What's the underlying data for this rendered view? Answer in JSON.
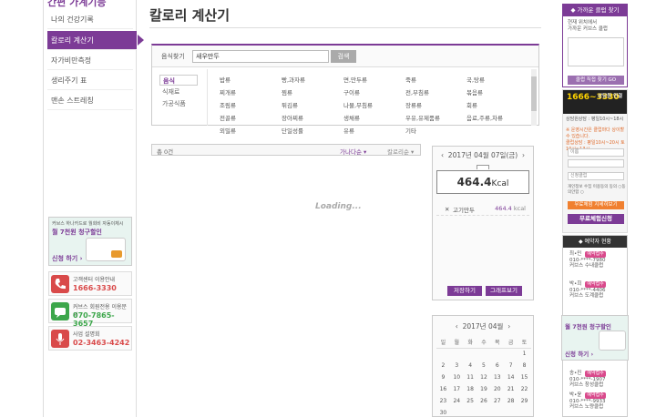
{
  "sidebar": {
    "title": "간편 가계기능",
    "items": [
      {
        "label": "나의 건강기록"
      },
      {
        "label": "칼로리 계산기"
      },
      {
        "label": "자가비만측정"
      },
      {
        "label": "생리주기 표"
      },
      {
        "label": "맨손 스트레칭"
      }
    ],
    "promo": {
      "line1": "커브스 하나카드로 월회비 자동이체시",
      "line2": "월 7천원 청구할인",
      "cta": "신청 하기 ›"
    },
    "contacts": [
      {
        "icon": "phone-icon",
        "label": "고객센터 이용안내",
        "number": "1666-3330",
        "color": "#d94a4a"
      },
      {
        "icon": "chat-icon",
        "label": "커브스 회원전용 이용문의",
        "number": "070-7865-3657",
        "color": "#3ca64a"
      },
      {
        "icon": "mic-icon",
        "label": "사업 설명회",
        "number": "02-3463-4242",
        "color": "#d94a4a"
      }
    ]
  },
  "page": {
    "title": "칼로리 계산기"
  },
  "search": {
    "label": "음식찾기",
    "value": "새우만두",
    "button": "검색"
  },
  "categories": [
    {
      "label": "음식",
      "selected": true
    },
    {
      "label": "식재료",
      "selected": false
    },
    {
      "label": "가공식품",
      "selected": false
    }
  ],
  "food_groups": [
    [
      "밥류",
      "찌개류",
      "조림류",
      "전골류",
      "외밀류"
    ],
    [
      "빵,과자류",
      "찜류",
      "튀김류",
      "장아찌류",
      "단일성률"
    ],
    [
      "면,만두류",
      "구이류",
      "나물,무침류",
      "생채류",
      "유류"
    ],
    [
      "죽류",
      "전,부침류",
      "장류류",
      "우유,유제품류",
      "기타"
    ],
    [
      "국,탕류",
      "볶음류",
      "회류",
      "음료,주류,차류"
    ]
  ],
  "results": {
    "count": "총 0건",
    "sort1": "가나다순",
    "sort2": "칼로리순",
    "loading": "Loading..."
  },
  "calc": {
    "date": "2017년 04월 07일(금)",
    "total": "464.4",
    "unit": "Kcal",
    "items": [
      {
        "name": "고기만두",
        "kcal": "464.4",
        "unit": "kcal"
      }
    ],
    "save": "저장하기",
    "graph": "그래프보기"
  },
  "calendar": {
    "title": "2017년 04월",
    "weekdays": [
      "일",
      "월",
      "화",
      "수",
      "목",
      "금",
      "토"
    ],
    "weeks": [
      [
        "",
        "",
        "",
        "",
        "",
        "",
        "1"
      ],
      [
        "2",
        "3",
        "4",
        "5",
        "6",
        "7",
        "8"
      ],
      [
        "9",
        "10",
        "11",
        "12",
        "13",
        "14",
        "15"
      ],
      [
        "16",
        "17",
        "18",
        "19",
        "20",
        "21",
        "22"
      ],
      [
        "23",
        "24",
        "25",
        "26",
        "27",
        "28",
        "29"
      ],
      [
        "30",
        "",
        "",
        "",
        "",
        "",
        ""
      ]
    ]
  },
  "right": {
    "map": {
      "header": "◆ 가까운 클럽 찾기",
      "text1": "현재 위치에서",
      "text2": "가까운 커브스 클럽",
      "button": "클럽 직접 찾기 GO"
    },
    "phone": {
      "number": "1666~3330",
      "label": "상담원 연결",
      "sub": "상담원상담 : 평일10시~18시",
      "notice": "※ 운영시간은 클럽마다 상이할 수 있습니다.",
      "hours": "클럽상담 : 평일10시~20시 토 10시~13시"
    },
    "form": {
      "name": "이름",
      "club": "신청클럽",
      "agree": "개인정보 수집 이용동의 동의 ○동의안함 ○",
      "btn1": "무료체험 지세히보기",
      "btn2": "무료체험신청"
    },
    "history": {
      "header": "◆ 예약자 현황",
      "items": [
        {
          "name": "최•민",
          "phone": "010-****-7980",
          "club": "커브스 수내클럽",
          "badge": "예약접수"
        },
        {
          "name": "박•희",
          "phone": "010-****-4406",
          "club": "커브스 도계클럽",
          "badge": "예약접수"
        },
        {
          "name": "송•진",
          "phone": "010-****-1907",
          "club": "커브스 창성클럽",
          "badge": "예약접수"
        },
        {
          "name": "박•윤",
          "phone": "010-****-9933",
          "club": "커브스 노량클럽",
          "badge": "예약접수"
        }
      ],
      "promo_title": "월 7천원 청구할인",
      "promo_cta": "신청 하기 ›"
    }
  }
}
